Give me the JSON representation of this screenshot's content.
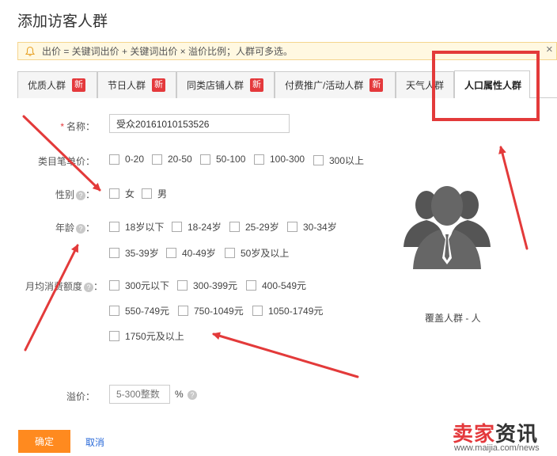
{
  "dialog": {
    "title": "添加访客人群",
    "close": "×"
  },
  "notice": {
    "text": "出价 = 关键词出价 + 关键词出价 × 溢价比例；人群可多选。"
  },
  "tabs": [
    {
      "label": "优质人群",
      "new": "新"
    },
    {
      "label": "节日人群",
      "new": "新"
    },
    {
      "label": "同类店铺人群",
      "new": "新"
    },
    {
      "label": "付费推广/活动人群",
      "new": "新"
    },
    {
      "label": "天气人群",
      "new": ""
    },
    {
      "label": "人口属性人群",
      "new": ""
    }
  ],
  "form": {
    "name": {
      "label": "名称：",
      "required": "*",
      "value": "受众20161010153526"
    },
    "price_per": {
      "label": "类目笔单价：",
      "options": [
        "0-20",
        "20-50",
        "50-100",
        "100-300",
        "300以上"
      ]
    },
    "gender": {
      "label": "性别",
      "suffix": "：",
      "help": "?",
      "options": [
        "女",
        "男"
      ]
    },
    "age": {
      "label": "年龄",
      "suffix": "：",
      "help": "?",
      "options": [
        "18岁以下",
        "18-24岁",
        "25-29岁",
        "30-34岁",
        "35-39岁",
        "40-49岁",
        "50岁及以上"
      ]
    },
    "monthly": {
      "label": "月均消费额度",
      "suffix": "：",
      "help": "?",
      "options": [
        "300元以下",
        "300-399元",
        "400-549元",
        "550-749元",
        "750-1049元",
        "1050-1749元",
        "1750元及以上"
      ]
    },
    "premium": {
      "label": "溢价：",
      "placeholder": "5-300整数",
      "unit": "%",
      "help": "?"
    }
  },
  "coverage": {
    "text": "覆盖人群 - 人"
  },
  "buttons": {
    "ok": "确定",
    "cancel": "取消"
  },
  "watermark": {
    "part1": "卖家",
    "part2": "资讯",
    "url": "www.maijia.com/news"
  },
  "colors": {
    "accent": "#ff8a1f",
    "new_badge": "#e4393c",
    "annotation": "#e33a3a",
    "link": "#2a6ad9"
  }
}
